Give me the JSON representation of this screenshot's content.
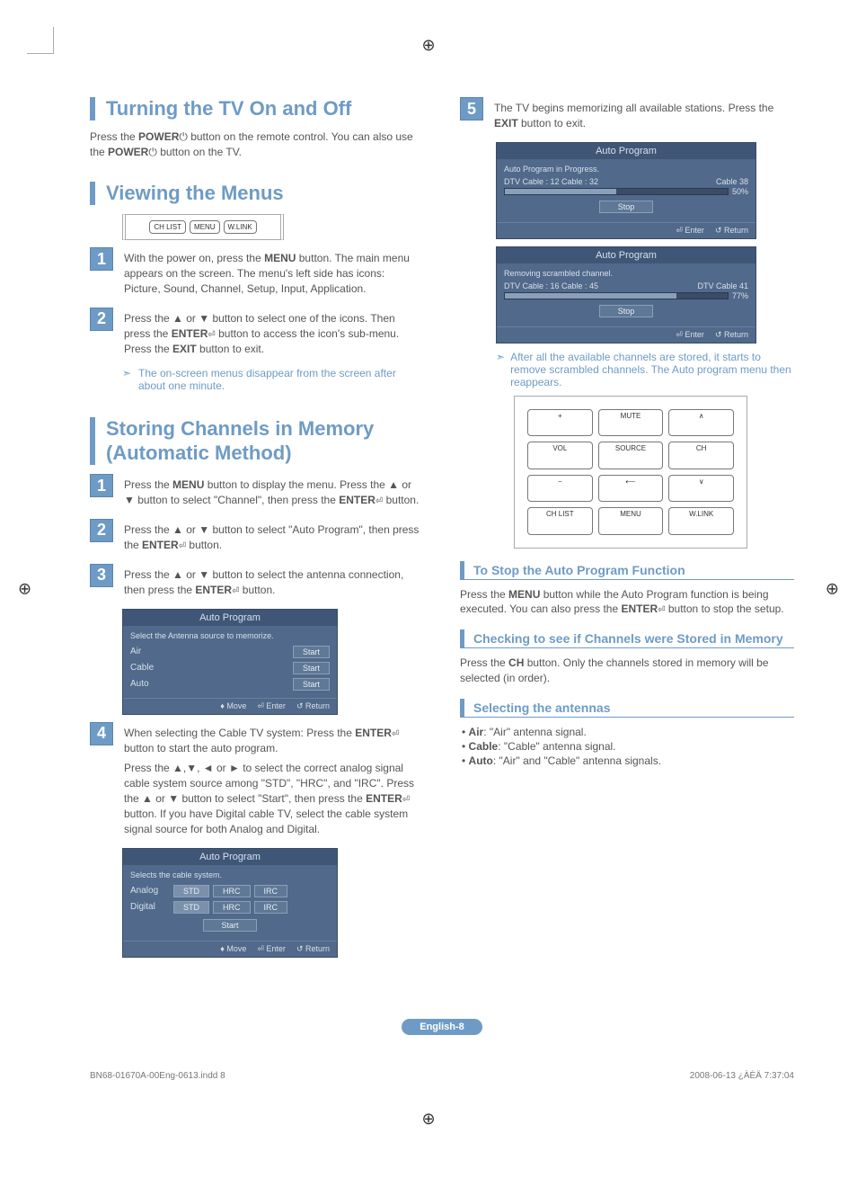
{
  "sections": {
    "turning": {
      "title": "Turning the TV On and Off",
      "p1a": "Press the ",
      "p1b": "POWER",
      "p1c": " button on the remote control. You can also use the ",
      "p1d": "POWER",
      "p1e": " button on the TV."
    },
    "viewing": {
      "title": "Viewing the Menus",
      "remote_buttons": [
        "CH LIST",
        "MENU",
        "W.LINK"
      ],
      "step1": {
        "num": "1",
        "t1": "With the power on, press the ",
        "t2": "MENU",
        "t3": " button. The main menu appears on the screen. The menu's left side has icons: Picture, Sound, Channel, Setup, Input, Application."
      },
      "step2": {
        "num": "2",
        "t1": "Press the ▲ or ▼ button to select one of the icons. Then press the ",
        "t2": "ENTER",
        "t3": " button to access the icon's sub-menu. Press the ",
        "t4": "EXIT",
        "t5": " button to exit."
      },
      "note": "The on-screen menus disappear from the screen after about one minute."
    },
    "storing": {
      "title": "Storing Channels in Memory (Automatic Method)",
      "step1": {
        "num": "1",
        "t1": "Press the ",
        "t2": "MENU",
        "t3": " button to display the menu. Press the ▲ or ▼ button to select \"Channel\", then press the ",
        "t4": "ENTER",
        "t5": " button."
      },
      "step2": {
        "num": "2",
        "t1": "Press the ▲ or ▼ button to select \"Auto Program\", then press the ",
        "t2": "ENTER",
        "t3": " button."
      },
      "step3": {
        "num": "3",
        "t1": "Press the ▲ or ▼ button to select the antenna connection, then press the ",
        "t2": "ENTER",
        "t3": " button."
      },
      "osd1": {
        "title": "Auto Program",
        "subtitle": "Select the Antenna source to memorize.",
        "rows": [
          {
            "label": "Air",
            "btn": "Start"
          },
          {
            "label": "Cable",
            "btn": "Start"
          },
          {
            "label": "Auto",
            "btn": "Start"
          }
        ],
        "foot": [
          "♦ Move",
          "⏎ Enter",
          "↺ Return"
        ]
      },
      "step4": {
        "num": "4",
        "t1": "When selecting the Cable TV system: Press the ",
        "t2": "ENTER",
        "t3": " button to start the auto program.",
        "p2": "Press the ▲,▼, ◄ or ► to select the correct analog signal cable system source among \"STD\", \"HRC\", and \"IRC\". Press the ▲ or ▼ button to select \"Start\", then press the ",
        "p2b": "ENTER",
        "p2c": " button. If you have Digital cable TV, select the cable system signal source for both Analog and Digital."
      },
      "osd2": {
        "title": "Auto Program",
        "subtitle": "Selects the cable system.",
        "rows": [
          {
            "label": "Analog",
            "opts": [
              "STD",
              "HRC",
              "IRC"
            ]
          },
          {
            "label": "Digital",
            "opts": [
              "STD",
              "HRC",
              "IRC"
            ]
          }
        ],
        "start": "Start",
        "foot": [
          "♦ Move",
          "⏎ Enter",
          "↺ Return"
        ]
      }
    },
    "right": {
      "step5": {
        "num": "5",
        "t1": "The TV begins memorizing all available stations. Press the ",
        "t2": "EXIT",
        "t3": " button to exit."
      },
      "osd_prog1": {
        "title": "Auto Program",
        "line1": "Auto Program in Progress.",
        "line2": "DTV Cable : 12  Cable : 32",
        "right_label": "Cable 38",
        "pct": "50%",
        "stop": "Stop",
        "foot": [
          "⏎ Enter",
          "↺ Return"
        ]
      },
      "osd_prog2": {
        "title": "Auto Program",
        "line1": "Removing scrambled channel.",
        "line2": "DTV Cable : 16  Cable : 45",
        "right_label": "DTV Cable 41",
        "pct": "77%",
        "stop": "Stop",
        "foot": [
          "⏎ Enter",
          "↺ Return"
        ]
      },
      "note": "After all the available channels are stored, it starts to remove scrambled channels. The Auto program menu then reappears.",
      "remote_big": [
        "+",
        "MUTE",
        "∧",
        "VOL",
        "SOURCE",
        "CH",
        "−",
        "⟵",
        "∨",
        "CH LIST",
        "MENU",
        "W.LINK"
      ],
      "sub1": {
        "title": "To Stop the Auto Program Function",
        "t1": "Press the ",
        "t2": "MENU",
        "t3": " button while the Auto Program function is being executed. You can also press the ",
        "t4": "ENTER",
        "t5": " button to stop the setup."
      },
      "sub2": {
        "title": "Checking to see if Channels were Stored in Memory",
        "t1": "Press the ",
        "t2": "CH",
        "t3": " button. Only the channels stored in memory will be selected (in order)."
      },
      "sub3": {
        "title": "Selecting the antennas",
        "b1": "• Air: \"Air\" antenna signal.",
        "b2": "• Cable: \"Cable\" antenna signal.",
        "b3": "• Auto: \"Air\" and \"Cable\" antenna signals."
      }
    }
  },
  "page_label": "English-8",
  "footer_left": "BN68-01670A-00Eng-0613.indd   8",
  "footer_right": "2008-06-13   ¿ÀÈÄ 7:37:04"
}
